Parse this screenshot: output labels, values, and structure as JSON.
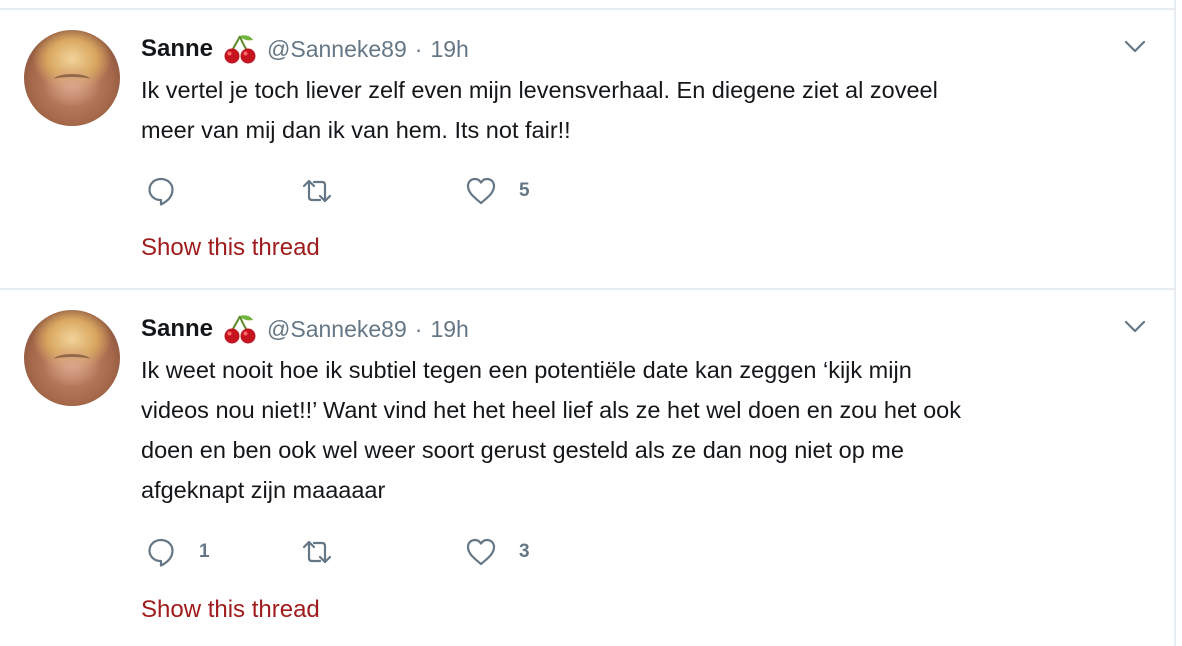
{
  "tweets": [
    {
      "name": "Sanne",
      "emoji": "cherries-emoji",
      "handle": "@Sanneke89",
      "separator": "·",
      "time": "19h",
      "lines": [
        "Ik vertel je toch liever zelf even mijn levensverhaal. En diegene ziet al zoveel",
        "meer van mij dan ik van hem. Its not fair!!"
      ],
      "reply_count": "",
      "retweet_count": "",
      "like_count": "5",
      "show_thread": "Show this thread"
    },
    {
      "name": "Sanne",
      "emoji": "cherries-emoji",
      "handle": "@Sanneke89",
      "separator": "·",
      "time": "19h",
      "lines": [
        "Ik weet nooit hoe ik subtiel tegen een potentiële date kan zeggen ‘kijk mijn",
        "videos nou niet!!’ Want vind het het heel lief als ze het wel doen en zou het ook",
        "doen en ben ook wel weer soort gerust gesteld als ze dan nog niet op me",
        "afgeknapt zijn maaaaar"
      ],
      "reply_count": "1",
      "retweet_count": "",
      "like_count": "3",
      "show_thread": "Show this thread"
    }
  ],
  "colors": {
    "text": "#14171a",
    "muted": "#657786",
    "link": "#a01c1c",
    "divider": "#e6ecf0"
  }
}
